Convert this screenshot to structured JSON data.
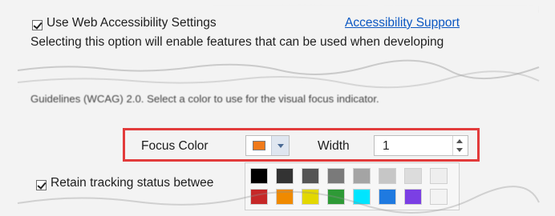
{
  "settings": {
    "use_web_accessibility": {
      "label": "Use Web Accessibility Settings",
      "checked": true
    },
    "accessibility_support_link": "Accessibility Support",
    "description_line_1": "Selecting this option will enable features that can be used when developing",
    "description_line_2": "Guidelines (WCAG) 2.0. Select a color to use for the visual focus indicator.",
    "retain_tracking": {
      "label": "Retain tracking status betwee",
      "checked": true
    }
  },
  "focus_toolbar": {
    "focus_color_label": "Focus Color",
    "selected_color": "#f07a1a",
    "width_label": "Width",
    "width_value": "1",
    "highlight_color": "#e23b3b"
  },
  "palette": {
    "row_1": [
      "#000000",
      "#333333",
      "#555555",
      "#7a7a7a",
      "#a4a4a4",
      "#c6c6c6",
      "#dcdcdc",
      "#eeeeee"
    ],
    "row_2": [
      "#c62828",
      "#f08a00",
      "#e3d800",
      "#2e9a36",
      "#00e5ff",
      "#1f7ae0",
      "#7b3fe4",
      "#f3f3f3"
    ]
  },
  "icons": {
    "dropdown": "chevron-down-icon",
    "spinner_up": "spin-up-icon",
    "spinner_down": "spin-down-icon",
    "checkbox_checked": "check-icon"
  }
}
